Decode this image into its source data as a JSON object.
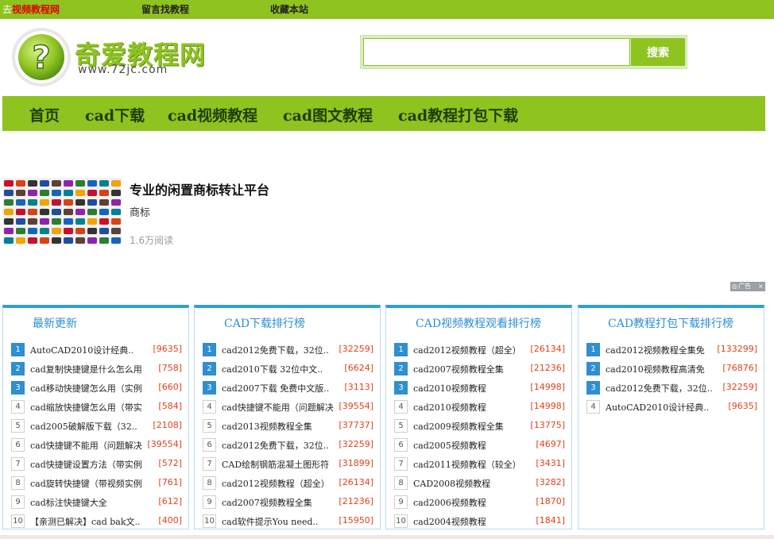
{
  "topbar": {
    "link1_prefix": "去",
    "link1_red": "视频教程网",
    "link2": "留言找教程",
    "link3": "收藏本站"
  },
  "logo": {
    "name": "奇爱教程网",
    "url": "www.72jc.com"
  },
  "search": {
    "value": "",
    "button_label": "搜索"
  },
  "nav": {
    "items": [
      "首页",
      "cad下载",
      "cad视频教程",
      "cad图文教程",
      "cad教程打包下载"
    ]
  },
  "ad": {
    "title": "专业的闲置商标转让平台",
    "subtitle": "商标",
    "reads": "1.6万阅读",
    "badge_label": "广告",
    "badge_close": "×"
  },
  "boxes": [
    {
      "title": "最新更新",
      "items": [
        {
          "num": "1",
          "text": "AutoCAD2010设计经典..",
          "count": "[9635]"
        },
        {
          "num": "2",
          "text": "cad复制快捷键是什么怎么用",
          "count": "[758]"
        },
        {
          "num": "3",
          "text": "cad移动快捷键怎么用（实例",
          "count": "[660]"
        },
        {
          "num": "4",
          "text": "cad缩放快捷键怎么用（带实",
          "count": "[584]"
        },
        {
          "num": "5",
          "text": "cad2005破解版下载（32..",
          "count": "[2108]"
        },
        {
          "num": "6",
          "text": "cad快捷键不能用（问题解决",
          "count": "[39554]"
        },
        {
          "num": "7",
          "text": "cad快捷键设置方法（带实例",
          "count": "[572]"
        },
        {
          "num": "8",
          "text": "cad旋转快捷键（带视频实例",
          "count": "[761]"
        },
        {
          "num": "9",
          "text": "cad标注快捷键大全",
          "count": "[612]"
        },
        {
          "num": "10",
          "text": "【亲测已解决】cad bak文..",
          "count": "[400]"
        }
      ]
    },
    {
      "title": "CAD下载排行榜",
      "items": [
        {
          "num": "1",
          "text": "cad2012免费下载，32位..",
          "count": "[32259]"
        },
        {
          "num": "2",
          "text": "cad2010下载 32位中文..",
          "count": "[6624]"
        },
        {
          "num": "3",
          "text": "cad2007下载 免费中文版..",
          "count": "[3113]"
        },
        {
          "num": "4",
          "text": "cad快捷键不能用（问题解决",
          "count": "[39554]"
        },
        {
          "num": "5",
          "text": "cad2013视频教程全集",
          "count": "[37737]"
        },
        {
          "num": "6",
          "text": "cad2012免费下载，32位..",
          "count": "[32259]"
        },
        {
          "num": "7",
          "text": "CAD绘制钢筋混凝土图形符",
          "count": "[31899]"
        },
        {
          "num": "8",
          "text": "cad2012视频教程（超全）",
          "count": "[26134]"
        },
        {
          "num": "9",
          "text": "cad2007视频教程全集",
          "count": "[21236]"
        },
        {
          "num": "10",
          "text": "cad软件提示You need..",
          "count": "[15950]"
        }
      ]
    },
    {
      "title": "CAD视频教程观看排行榜",
      "items": [
        {
          "num": "1",
          "text": "cad2012视频教程（超全）",
          "count": "[26134]"
        },
        {
          "num": "2",
          "text": "cad2007视频教程全集",
          "count": "[21236]"
        },
        {
          "num": "3",
          "text": "cad2010视频教程",
          "count": "[14998]"
        },
        {
          "num": "4",
          "text": "cad2010视频教程",
          "count": "[14998]"
        },
        {
          "num": "5",
          "text": "cad2009视频教程全集",
          "count": "[13775]"
        },
        {
          "num": "6",
          "text": "cad2005视频教程",
          "count": "[4697]"
        },
        {
          "num": "7",
          "text": "cad2011视频教程（较全）",
          "count": "[3431]"
        },
        {
          "num": "8",
          "text": "CAD2008视频教程",
          "count": "[3282]"
        },
        {
          "num": "9",
          "text": "cad2006视频教程",
          "count": "[1870]"
        },
        {
          "num": "10",
          "text": "cad2004视频教程",
          "count": "[1841]"
        }
      ]
    },
    {
      "title": "CAD教程打包下载排行榜",
      "items": [
        {
          "num": "1",
          "text": "cad2012视频教程全集免",
          "count": "[133299]"
        },
        {
          "num": "2",
          "text": "cad2010视频教程高清免",
          "count": "[76876]"
        },
        {
          "num": "3",
          "text": "cad2012免费下载，32位..",
          "count": "[32259]"
        },
        {
          "num": "4",
          "text": "AutoCAD2010设计经典..",
          "count": "[9635]"
        }
      ]
    }
  ]
}
